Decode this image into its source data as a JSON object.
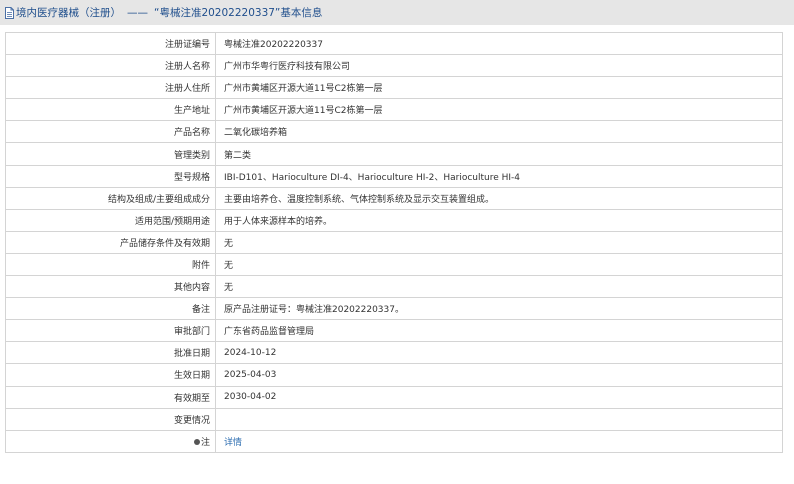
{
  "header": {
    "icon": "document-icon",
    "category": "境内医疗器械（注册）",
    "separator": "——",
    "title": "“粤械注准20202220337”基本信息"
  },
  "rows": [
    {
      "label": "注册证编号",
      "value": "粤械注准20202220337"
    },
    {
      "label": "注册人名称",
      "value": "广州市华粤行医疗科技有限公司"
    },
    {
      "label": "注册人住所",
      "value": "广州市黄埔区开源大道11号C2栋第一层"
    },
    {
      "label": "生产地址",
      "value": "广州市黄埔区开源大道11号C2栋第一层"
    },
    {
      "label": "产品名称",
      "value": "二氧化碳培养箱"
    },
    {
      "label": "管理类别",
      "value": "第二类"
    },
    {
      "label": "型号规格",
      "value": "IBI-D101、Harioculture DI-4、Harioculture HI-2、Harioculture HI-4"
    },
    {
      "label": "结构及组成/主要组成成分",
      "value": "主要由培养仓、温度控制系统、气体控制系统及显示交互装置组成。"
    },
    {
      "label": "适用范围/预期用途",
      "value": "用于人体来源样本的培养。"
    },
    {
      "label": "产品储存条件及有效期",
      "value": "无"
    },
    {
      "label": "附件",
      "value": "无"
    },
    {
      "label": "其他内容",
      "value": "无"
    },
    {
      "label": "备注",
      "value": "原产品注册证号：粤械注准20202220337。"
    },
    {
      "label": "审批部门",
      "value": "广东省药品监督管理局"
    },
    {
      "label": "批准日期",
      "value": "2024-10-12"
    },
    {
      "label": "生效日期",
      "value": "2025-04-03"
    },
    {
      "label": "有效期至",
      "value": "2030-04-02"
    },
    {
      "label": "变更情况",
      "value": ""
    }
  ],
  "note_row": {
    "label": "注",
    "icon": "note-dot-icon",
    "link": "详情"
  }
}
